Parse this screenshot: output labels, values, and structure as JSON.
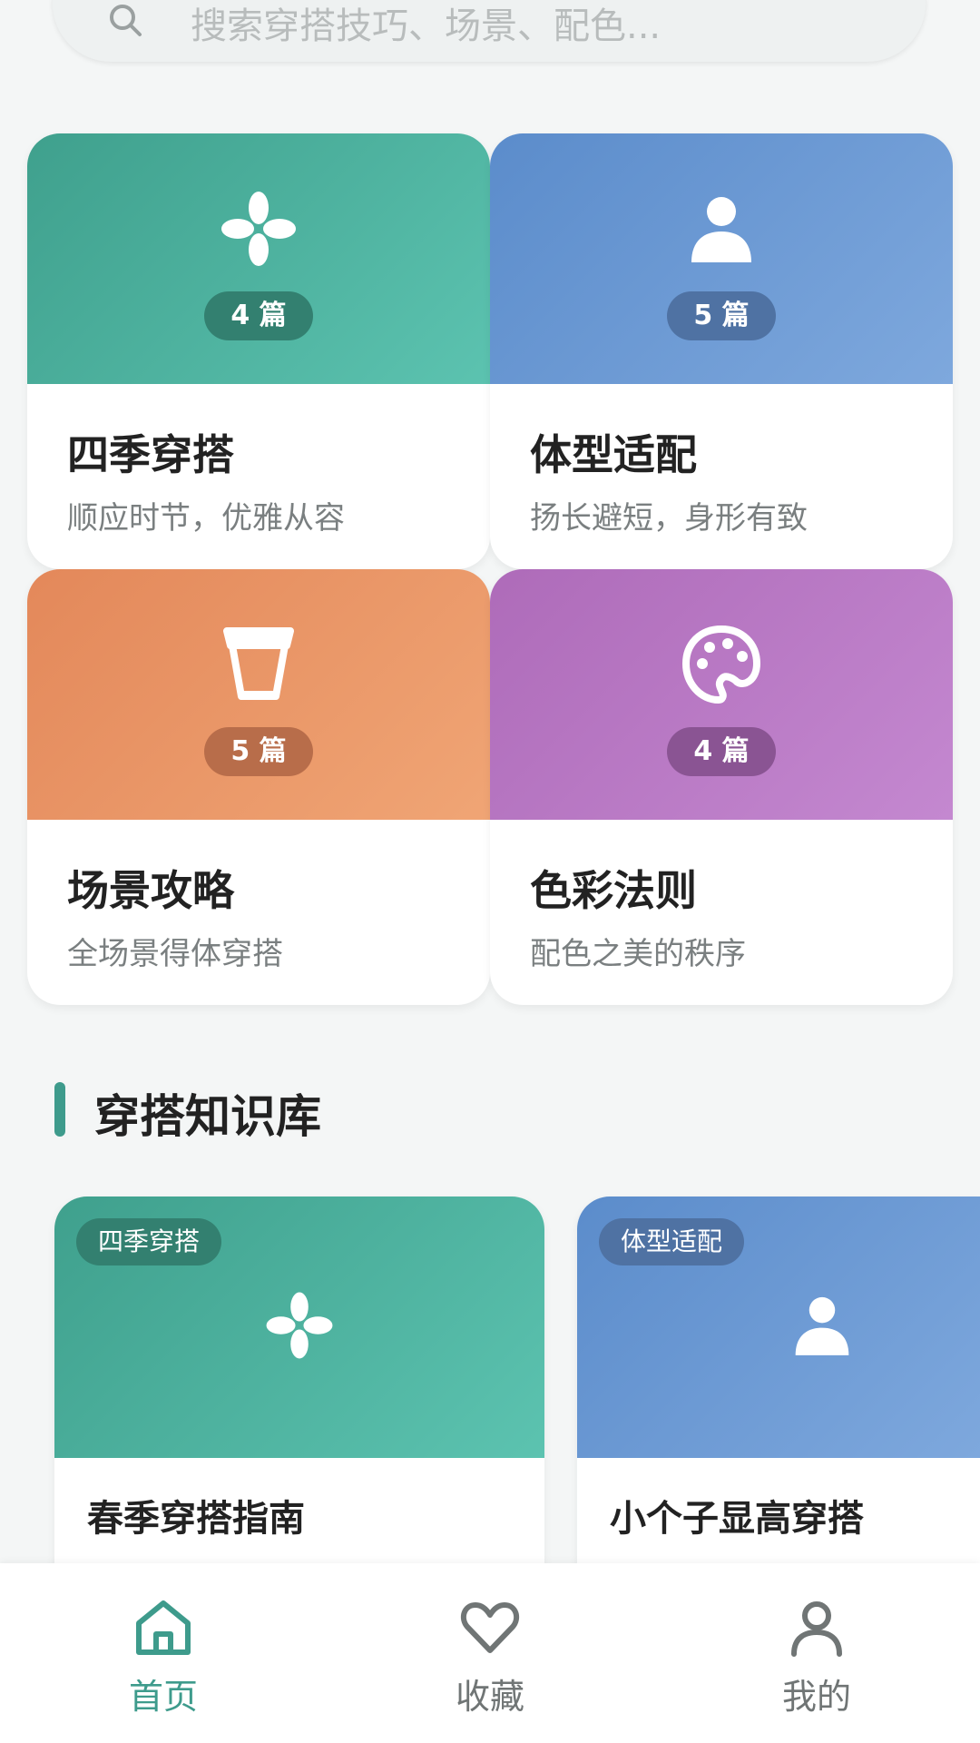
{
  "search": {
    "placeholder": "搜索穿搭技巧、场景、配色..."
  },
  "categories": [
    {
      "title": "四季穿搭",
      "subtitle": "顺应时节，优雅从容",
      "count": "4 篇",
      "icon": "leaf-flower-icon",
      "color_from": "#3fa08d",
      "color_to": "#5cc3b0",
      "badge": "#338070"
    },
    {
      "title": "体型适配",
      "subtitle": "扬长避短，身形有致",
      "count": "5 篇",
      "icon": "person-icon",
      "color_from": "#5b8ccb",
      "color_to": "#7ea8dd",
      "badge": "#4f72a3"
    },
    {
      "title": "场景攻略",
      "subtitle": "全场景得体穿搭",
      "count": "5 篇",
      "icon": "cup-icon",
      "color_from": "#e3885a",
      "color_to": "#f0a575",
      "badge": "#b86d4a"
    },
    {
      "title": "色彩法则",
      "subtitle": "配色之美的秩序",
      "count": "4 篇",
      "icon": "palette-icon",
      "color_from": "#ae6bb9",
      "color_to": "#c488d0",
      "badge": "#8a5493"
    }
  ],
  "section": {
    "title": "穿搭知识库"
  },
  "knowledge": [
    {
      "tag": "四季穿搭",
      "title": "春季穿搭指南",
      "icon": "leaf-flower-icon",
      "color_from": "#3fa08d",
      "color_to": "#5cc3b0",
      "tag_bg": "#338070"
    },
    {
      "tag": "体型适配",
      "title": "小个子显高穿搭",
      "icon": "person-icon",
      "color_from": "#5b8ccb",
      "color_to": "#7ea8dd",
      "tag_bg": "#4f72a3"
    }
  ],
  "nav": {
    "items": [
      {
        "label": "首页",
        "icon": "home-icon",
        "active": true
      },
      {
        "label": "收藏",
        "icon": "heart-icon",
        "active": false
      },
      {
        "label": "我的",
        "icon": "user-icon",
        "active": false
      }
    ],
    "active_color": "#3e9b8c",
    "inactive_color": "#707575"
  }
}
